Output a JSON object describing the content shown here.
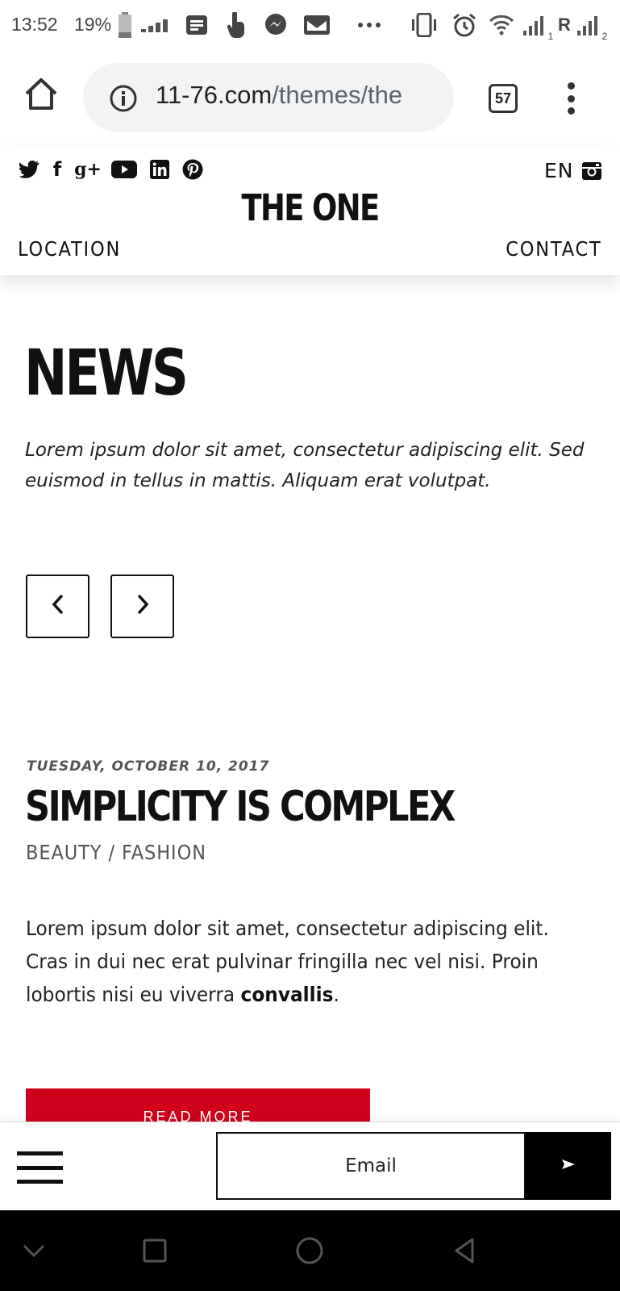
{
  "status_bar": {
    "time": "13:52",
    "battery": "19%",
    "icons": [
      "battery-icon",
      "data-icon",
      "news-icon",
      "touch-icon",
      "messenger-icon",
      "gmail-icon",
      "more-icon",
      "vibrate-icon",
      "alarm-icon",
      "wifi-icon",
      "signal-1-icon",
      "roaming-r",
      "signal-2-icon"
    ],
    "roaming": "R",
    "sim1": "1",
    "sim2": "2"
  },
  "browser": {
    "url_host": "11-76.com",
    "url_path": "/themes/the",
    "tab_count": "57"
  },
  "site": {
    "social_icons": [
      "twitter-icon",
      "facebook-icon",
      "google-plus-icon",
      "youtube-icon",
      "linkedin-icon",
      "pinterest-icon"
    ],
    "facebook_glyph": "f",
    "gplus_glyph": "g+",
    "linkedin_glyph": "in",
    "language": "EN",
    "logo": "THE ONE",
    "nav_left": "LOCATION",
    "nav_right": "CONTACT"
  },
  "main": {
    "section_title": "NEWS",
    "intro": "Lorem ipsum dolor sit amet, consectetur adipiscing elit. Sed euismod in tellus in mattis. Aliquam erat volutpat."
  },
  "post": {
    "date": "TUESDAY, OCTOBER 10, 2017",
    "title": "SIMPLICITY IS COMPLEX",
    "categories": "BEAUTY / FASHION",
    "excerpt": "Lorem ipsum dolor sit amet, consectetur adipiscing elit. Cras in dui nec erat pulvinar fringilla nec vel nisi. Proin lobortis nisi eu viverra ",
    "excerpt_bold": "convallis",
    "excerpt_end": ".",
    "read_more": "READ MORE"
  },
  "footer_bar": {
    "email_placeholder": "Email"
  },
  "colors": {
    "accent_red": "#d0021b",
    "text": "#111111",
    "url_pill_bg": "#f1f3f4"
  }
}
